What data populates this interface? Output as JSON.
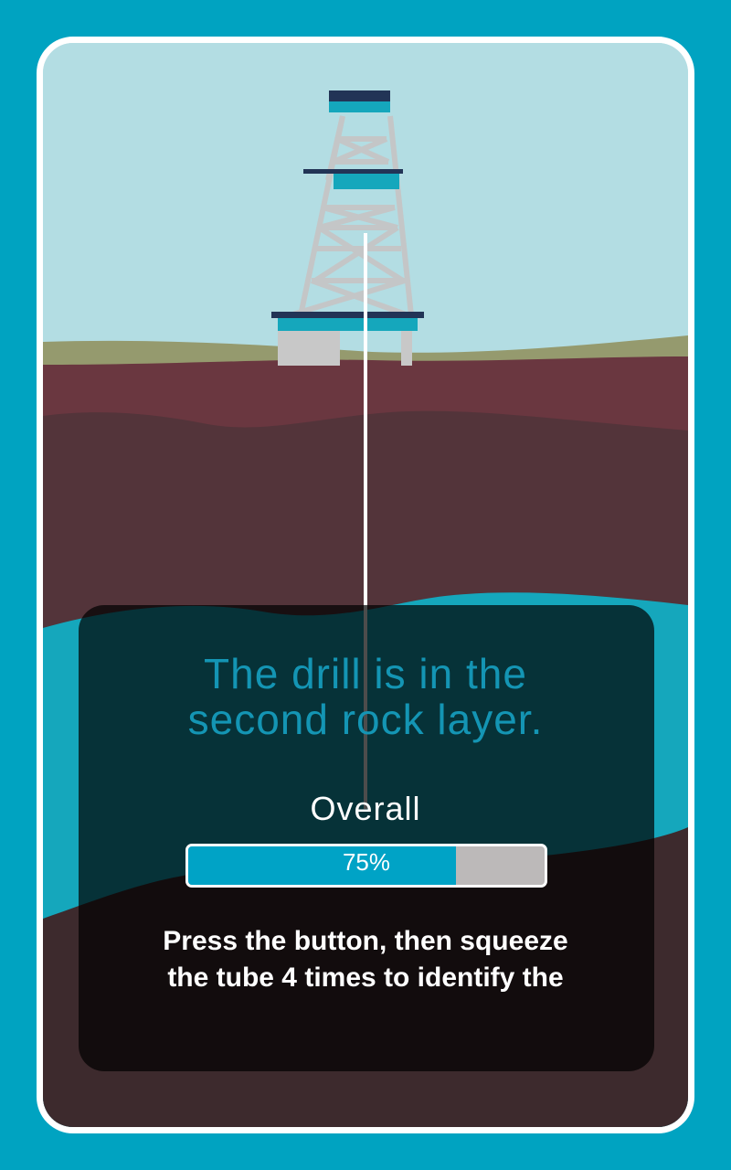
{
  "status": {
    "line1": "The drill is in the",
    "line2": "second rock layer."
  },
  "progress": {
    "label": "Overall",
    "value_percent": 75,
    "text": "75%"
  },
  "instructions": {
    "line1": "Press the button, then squeeze",
    "line2": "the tube 4 times to identify the"
  },
  "colors": {
    "background": "#00a3c1",
    "sky": "#b3dde3",
    "grass": "#959a6e",
    "topsoil": "#6a3740",
    "rock_layer_1": "#53343a",
    "rock_layer_2": "#15a7bc",
    "rock_layer_3": "#3d2a2d",
    "accent_text": "#1495b4",
    "progress_fill": "#00a3c6",
    "progress_track": "#bcb9b9"
  },
  "icons": {
    "rig": "drilling-rig-icon"
  }
}
